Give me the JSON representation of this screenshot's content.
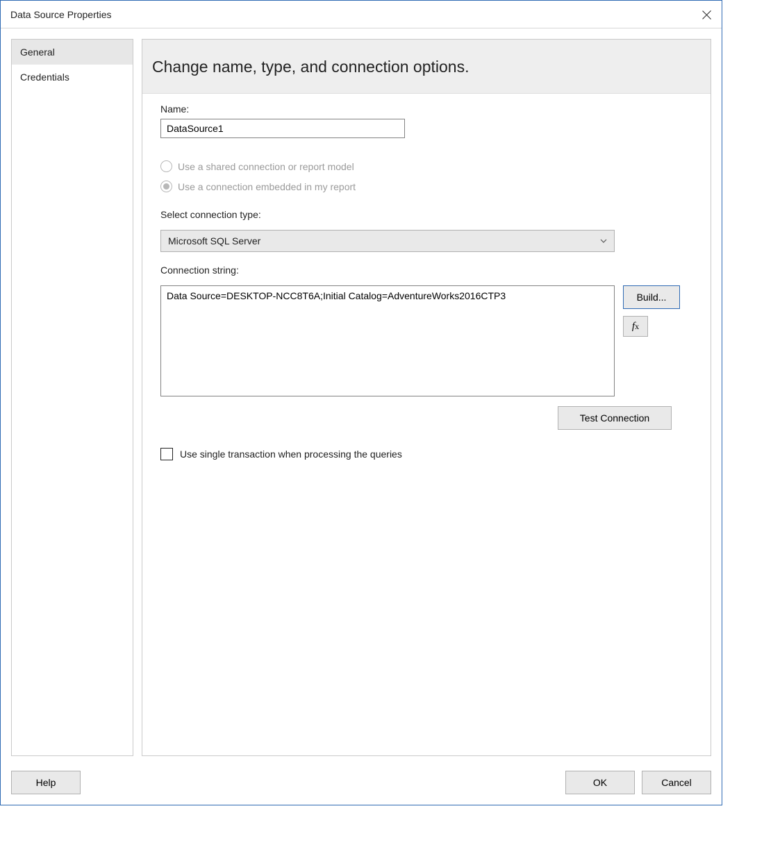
{
  "title": "Data Source Properties",
  "sidebar": {
    "items": [
      {
        "label": "General",
        "selected": true
      },
      {
        "label": "Credentials",
        "selected": false
      }
    ]
  },
  "panel": {
    "heading": "Change name, type, and connection options.",
    "name_label": "Name:",
    "name_value": "DataSource1",
    "radio_shared_label": "Use a shared connection or report model",
    "radio_embedded_label": "Use a connection embedded in my report",
    "connection_type_label": "Select connection type:",
    "connection_type_value": "Microsoft SQL Server",
    "connection_string_label": "Connection string:",
    "connection_string_value": "Data Source=DESKTOP-NCC8T6A;Initial Catalog=AdventureWorks2016CTP3",
    "build_button": "Build...",
    "fx_button": "fx",
    "test_connection_button": "Test Connection",
    "single_transaction_label": "Use single transaction when processing the queries"
  },
  "footer": {
    "help": "Help",
    "ok": "OK",
    "cancel": "Cancel"
  }
}
